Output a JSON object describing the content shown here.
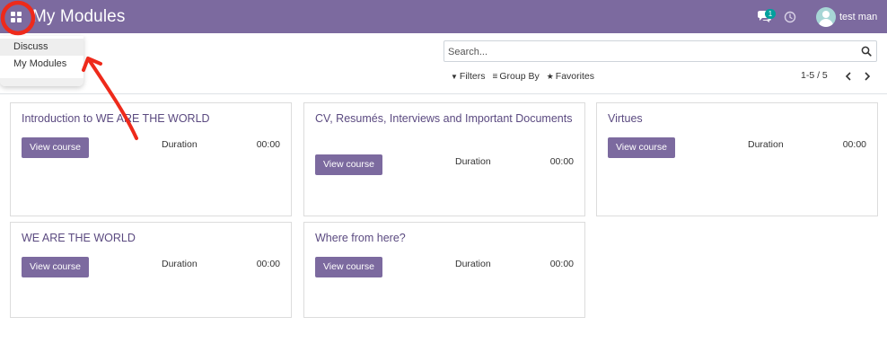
{
  "navbar": {
    "app_title": "My Modules",
    "chat_badge_count": "1",
    "user_name": "test man",
    "apps_icon": "apps-grid-icon",
    "chat_icon": "chat-icon",
    "clock_icon": "clock-icon",
    "background_color": "#7c6a9f"
  },
  "apps_menu": {
    "items": [
      {
        "label": "Discuss"
      },
      {
        "label": "My Modules"
      }
    ]
  },
  "search": {
    "placeholder": "Search...",
    "value": ""
  },
  "search_options": {
    "filters_label": "Filters",
    "group_by_label": "Group By",
    "favorites_label": "Favorites"
  },
  "pager": {
    "label": "1-5 / 5"
  },
  "courses": [
    {
      "title": "Introduction to WE ARE THE WORLD",
      "button_label": "View course",
      "duration_label": "Duration",
      "duration": "00:00"
    },
    {
      "title": "CV, Resumés, Interviews and Important Documents",
      "button_label": "View course",
      "duration_label": "Duration",
      "duration": "00:00"
    },
    {
      "title": "Virtues",
      "button_label": "View course",
      "duration_label": "Duration",
      "duration": "00:00"
    },
    {
      "title": "WE ARE THE WORLD",
      "button_label": "View course",
      "duration_label": "Duration",
      "duration": "00:00"
    },
    {
      "title": "Where from here?",
      "button_label": "View course",
      "duration_label": "Duration",
      "duration": "00:00"
    }
  ],
  "colors": {
    "accent": "#7c6a9f",
    "title_text": "#5b4a80",
    "annotation": "#ee2a1b"
  }
}
